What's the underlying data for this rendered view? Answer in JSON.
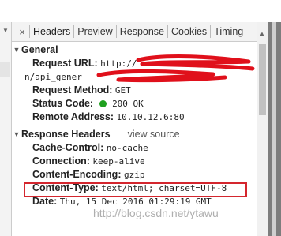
{
  "tabs": {
    "close": "×",
    "items": [
      {
        "label": "Headers"
      },
      {
        "label": "Preview"
      },
      {
        "label": "Response"
      },
      {
        "label": "Cookies"
      },
      {
        "label": "Timing"
      }
    ],
    "active": "Headers"
  },
  "general": {
    "title": "General",
    "request_url_key": "Request URL:",
    "request_url_value_start": "http://",
    "request_url_value_end": "i",
    "request_url_cont_start": "n/api_gener",
    "request_method_key": "Request Method:",
    "request_method_value": "GET",
    "status_code_key": "Status Code:",
    "status_code_value": "200 OK",
    "remote_address_key": "Remote Address:",
    "remote_address_value": "10.10.12.6:80"
  },
  "response_headers": {
    "title": "Response Headers",
    "view_source": "view source",
    "items": [
      {
        "key": "Cache-Control:",
        "value": "no-cache"
      },
      {
        "key": "Connection:",
        "value": "keep-alive"
      },
      {
        "key": "Content-Encoding:",
        "value": "gzip"
      },
      {
        "key": "Content-Type:",
        "value": "text/html; charset=UTF-8"
      },
      {
        "key": "Date:",
        "value": "Thu, 15 Dec 2016 01:29:19 GMT"
      }
    ]
  },
  "watermark": "http://blog.csdn.net/ytawu",
  "colors": {
    "highlight_box": "#d4262e",
    "scribble": "#e0101b",
    "status_dot": "#1fa01f"
  }
}
